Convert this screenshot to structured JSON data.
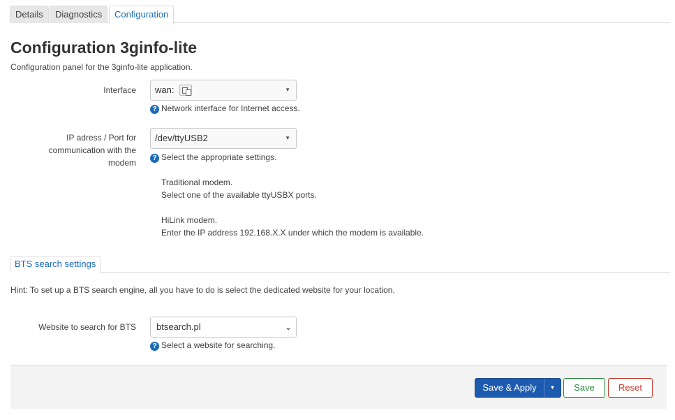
{
  "tabs": [
    "Details",
    "Diagnostics",
    "Configuration"
  ],
  "page_title": "Configuration 3ginfo-lite",
  "page_description": "Configuration panel for the 3ginfo-lite application.",
  "interface": {
    "label": "Interface",
    "value": "wan:",
    "icon": "network-interface-icon",
    "help": "Network interface for Internet access."
  },
  "port": {
    "label": "IP adress / Port for communication with the modem",
    "value": "/dev/ttyUSB2",
    "help": "Select the appropriate settings.",
    "notes": [
      "Traditional modem.",
      "Select one of the available ttyUSBX ports.",
      "HiLink modem.",
      "Enter the IP address 192.168.X.X under which the modem is available."
    ]
  },
  "section_tab": "BTS search settings",
  "hint": "Hint: To set up a BTS search engine, all you have to do is select the dedicated website for your location.",
  "website": {
    "label": "Website to search for BTS",
    "value": "btsearch.pl",
    "help": "Select a website for searching."
  },
  "buttons": {
    "save_apply": "Save & Apply",
    "save": "Save",
    "reset": "Reset"
  },
  "colors": {
    "accent": "#1d6bb7",
    "apply": "#1d5bb0",
    "save": "#2b8a3e",
    "reset": "#c23a2b"
  }
}
